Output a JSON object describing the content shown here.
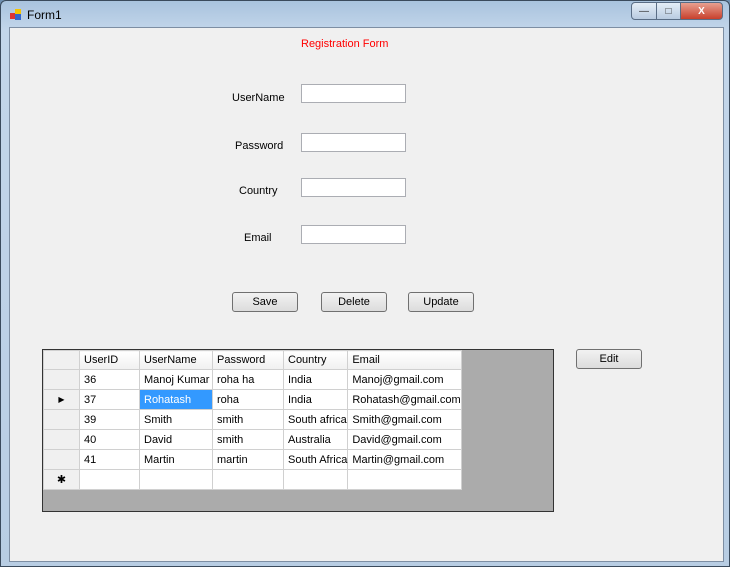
{
  "window": {
    "title": "Form1",
    "minimize": "—",
    "maximize": "□",
    "close": "X"
  },
  "form": {
    "heading": "Registration Form",
    "heading_color": "#ff0000",
    "fields": [
      {
        "label": "UserName",
        "value": ""
      },
      {
        "label": "Password",
        "value": ""
      },
      {
        "label": "Country",
        "value": ""
      },
      {
        "label": "Email",
        "value": ""
      }
    ],
    "buttons": {
      "save": "Save",
      "delete": "Delete",
      "update": "Update",
      "edit": "Edit"
    }
  },
  "grid": {
    "columns": [
      "UserID",
      "UserName",
      "Password",
      "Country",
      "Email"
    ],
    "rows": [
      [
        "36",
        "Manoj Kumar",
        "roha ha",
        "India",
        "Manoj@gmail.com"
      ],
      [
        "37",
        "Rohatash",
        "roha",
        "India",
        "Rohatash@gmail.com"
      ],
      [
        "39",
        "Smith",
        "smith",
        "South africa",
        "Smith@gmail.com"
      ],
      [
        "40",
        "David",
        "smith",
        "Australia",
        "David@gmail.com"
      ],
      [
        "41",
        "Martin",
        "martin",
        "South Africa",
        "Martin@gmail.com"
      ]
    ],
    "current_row_marker": "▶",
    "new_row_marker": "✱",
    "selected_cell": "Rohatash"
  }
}
